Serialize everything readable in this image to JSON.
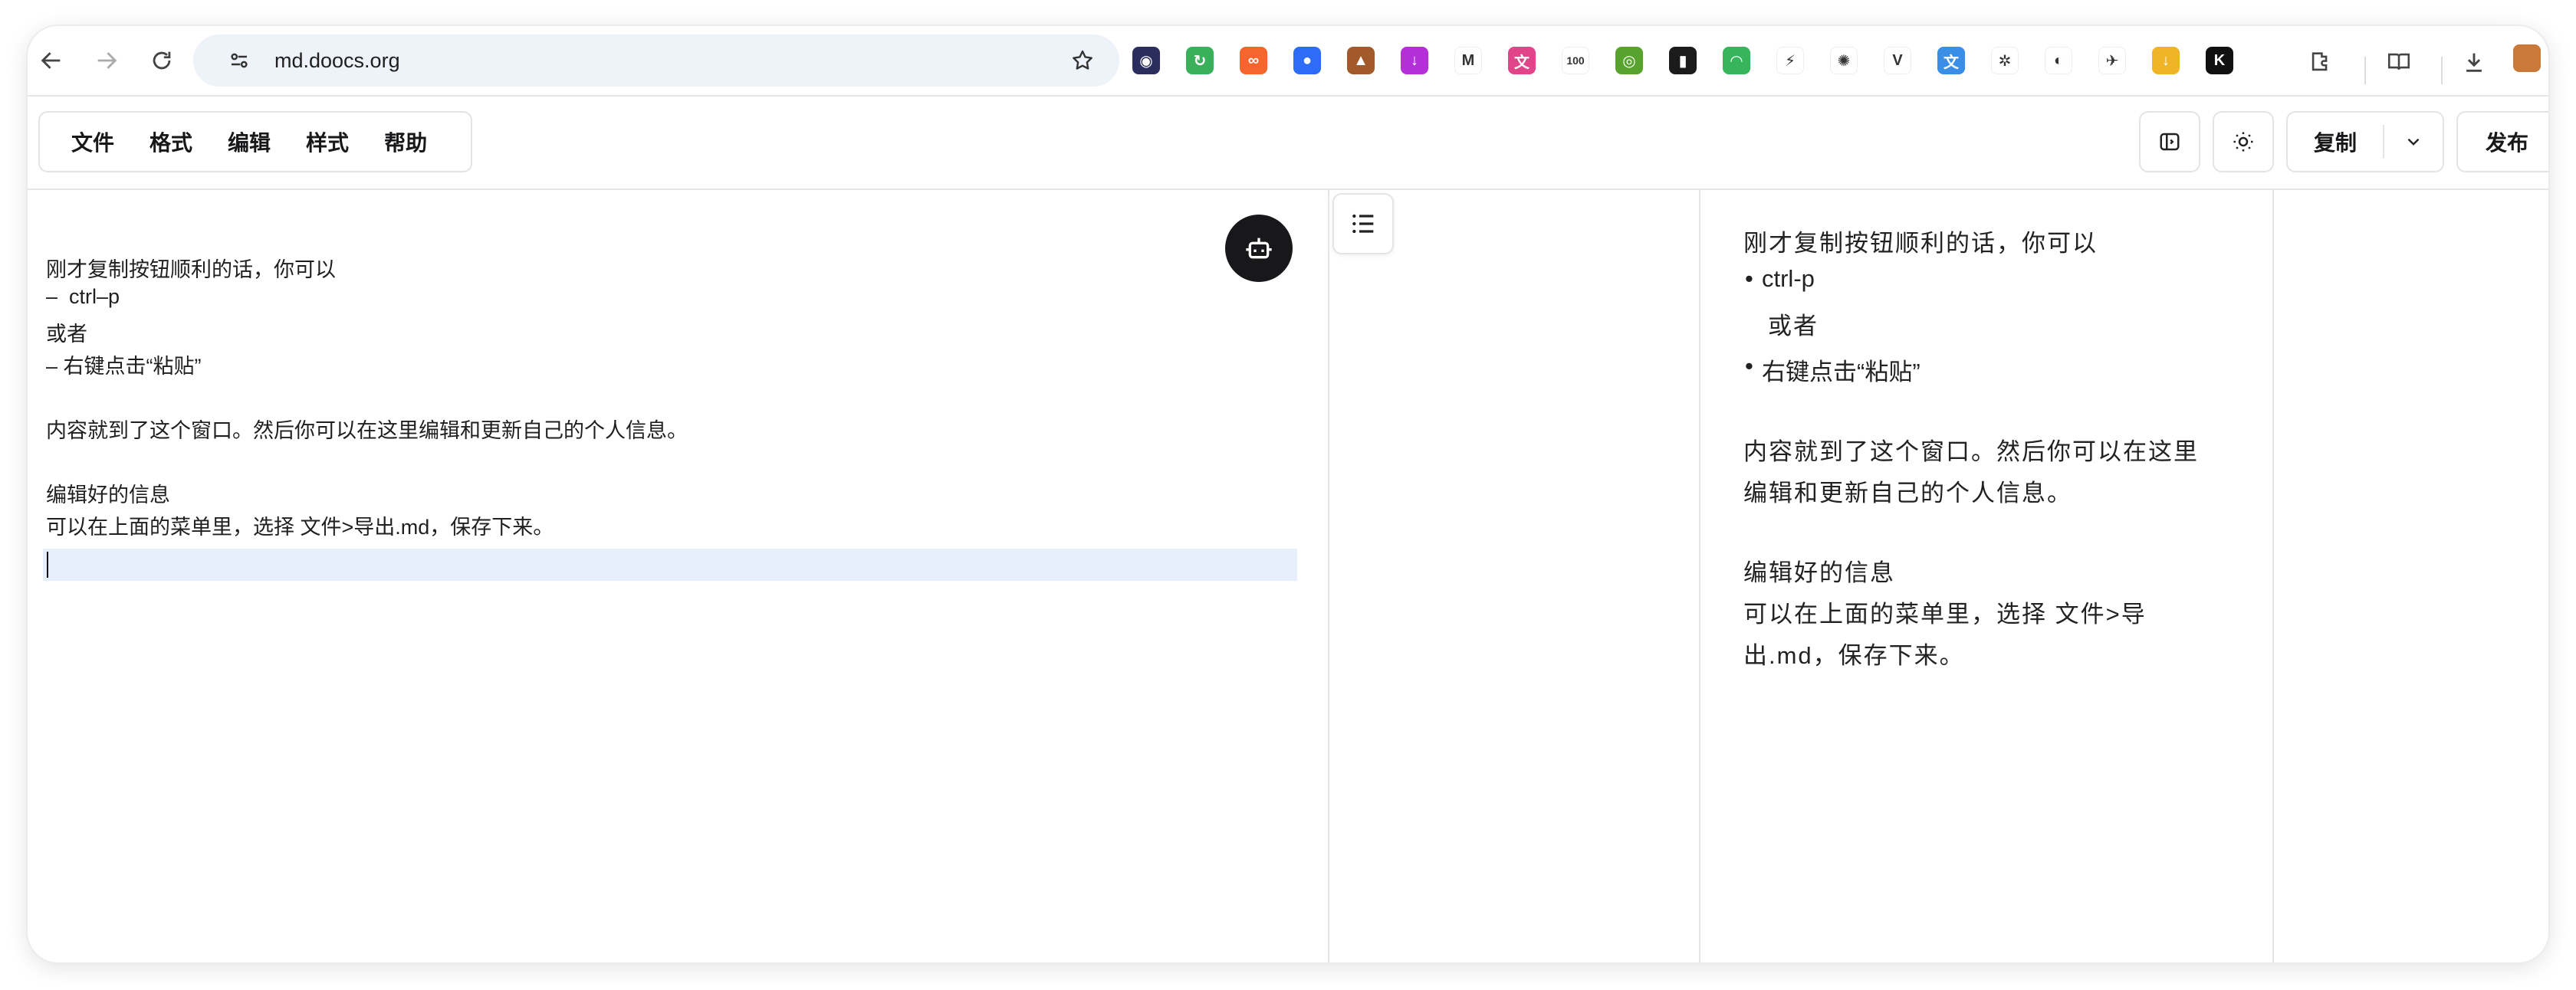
{
  "browser": {
    "url": "md.doocs.org",
    "extensions": [
      {
        "name": "ext-1",
        "color": "#2b2d5e",
        "glyph": "◉"
      },
      {
        "name": "ext-2",
        "color": "#3ab05b",
        "glyph": "↻"
      },
      {
        "name": "ext-3",
        "color": "#f5652d",
        "glyph": "∞"
      },
      {
        "name": "ext-4",
        "color": "#2d6cf6",
        "glyph": "●"
      },
      {
        "name": "ext-5",
        "color": "#a25a2a",
        "glyph": "▲"
      },
      {
        "name": "ext-6",
        "color": "#b330d9",
        "glyph": "↓"
      },
      {
        "name": "ext-7",
        "color": "#ffffff",
        "glyph": "M"
      },
      {
        "name": "ext-8",
        "color": "#e0458a",
        "glyph": "文"
      },
      {
        "name": "ext-9",
        "color": "#ffffff",
        "glyph": "100"
      },
      {
        "name": "ext-10",
        "color": "#58a32e",
        "glyph": "◎"
      },
      {
        "name": "ext-11",
        "color": "#1b1b1b",
        "glyph": "▮"
      },
      {
        "name": "ext-12",
        "color": "#36b55c",
        "glyph": "◠"
      },
      {
        "name": "ext-13",
        "color": "#ffffff",
        "glyph": "⚡"
      },
      {
        "name": "ext-14",
        "color": "#ffffff",
        "glyph": "✺"
      },
      {
        "name": "ext-15",
        "color": "#ffffff",
        "glyph": "V"
      },
      {
        "name": "ext-16",
        "color": "#3a8ee6",
        "glyph": "文"
      },
      {
        "name": "ext-17",
        "color": "#ffffff",
        "glyph": "✲"
      },
      {
        "name": "ext-18",
        "color": "#ffffff",
        "glyph": "◐"
      },
      {
        "name": "ext-19",
        "color": "#ffffff",
        "glyph": "✈"
      },
      {
        "name": "ext-20",
        "color": "#f0b526",
        "glyph": "↓"
      },
      {
        "name": "ext-21",
        "color": "#111111",
        "glyph": "K"
      }
    ]
  },
  "menu": [
    "文件",
    "格式",
    "编辑",
    "样式",
    "帮助"
  ],
  "toolbar": {
    "copy_label": "复制",
    "publish_label": "发布"
  },
  "editor": {
    "lines": [
      "刚才复制按钮顺利的话，你可以",
      "–  ctrl–p",
      "或者",
      "– 右键点击“粘贴”",
      "",
      "内容就到了这个窗口。然后你可以在这里编辑和更新自己的个人信息。",
      "",
      "编辑好的信息",
      "可以在上面的菜单里，选择 文件>导出.md，保存下来。"
    ]
  },
  "preview": {
    "p1": "刚才复制按钮顺利的话，你可以",
    "li1": "ctrl-p",
    "li1_cont": "或者",
    "li2": "右键点击“粘贴”",
    "p2a": "内容就到了这个窗口。然后你可以在这里",
    "p2b": "编辑和更新自己的个人信息。",
    "p3a": "编辑好的信息",
    "p3b": "可以在上面的菜单里，选择 文件>导",
    "p3c": "出.md，保存下来。",
    "bullet": "•"
  }
}
